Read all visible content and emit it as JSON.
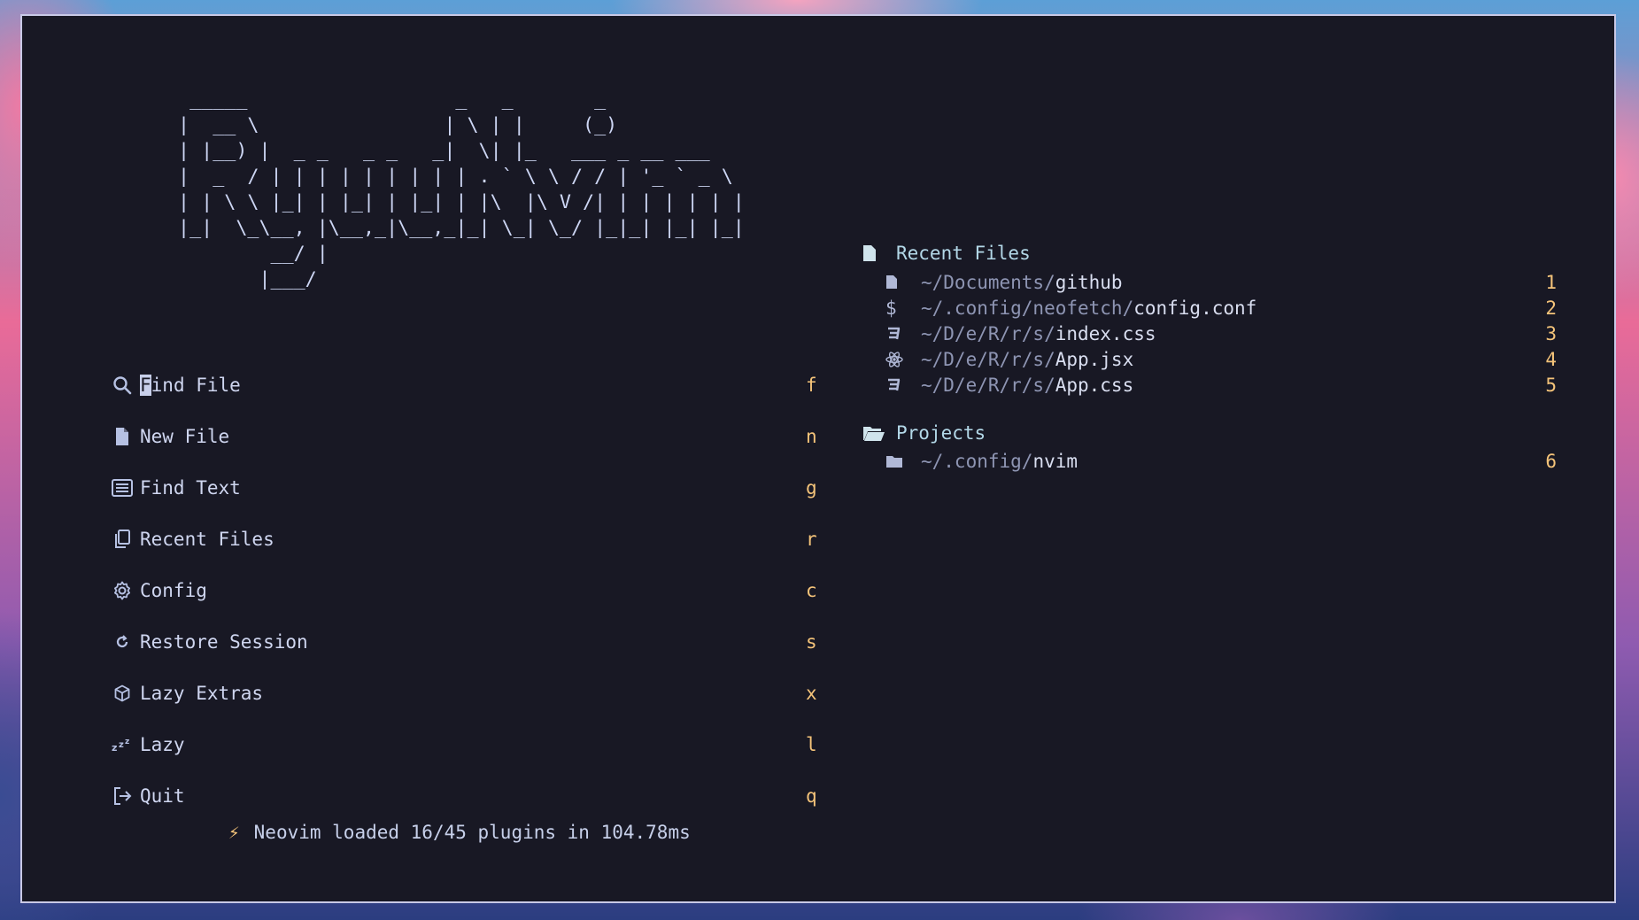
{
  "header_ascii": "  _____                  _   _       _\n |  __ \\                | \\ | |     (_)\n | |__) |  _ _   _ _   _|  \\| |_   ___ _ __ ___\n |  _  / | | | | | | | | | . ` \\ \\ / / | '_ ` _ \\\n | | \\ \\ |_| | |_| | |_| | |\\  |\\ V /| | | | | | |\n |_|  \\_\\__, |\\__,_|\\__,_|_| \\_| \\_/ |_|_| |_| |_|\n         __/ |\n        |___/",
  "menu": [
    {
      "icon": "search-icon",
      "label": "Find File",
      "key": "f"
    },
    {
      "icon": "file-icon",
      "label": "New File",
      "key": "n"
    },
    {
      "icon": "text-search-icon",
      "label": "Find Text",
      "key": "g"
    },
    {
      "icon": "copy-files-icon",
      "label": "Recent Files",
      "key": "r"
    },
    {
      "icon": "gear-icon",
      "label": "Config",
      "key": "c"
    },
    {
      "icon": "restore-icon",
      "label": "Restore Session",
      "key": "s"
    },
    {
      "icon": "cube-icon",
      "label": "Lazy Extras",
      "key": "x"
    },
    {
      "icon": "sleep-icon",
      "label": "Lazy",
      "key": "l"
    },
    {
      "icon": "exit-icon",
      "label": "Quit",
      "key": "q"
    }
  ],
  "recent_files": {
    "title": "Recent Files",
    "items": [
      {
        "icon": "file-icon",
        "dir": "~/Documents/",
        "name": "github",
        "key": "1"
      },
      {
        "icon": "dollar-icon",
        "dir": "~/.config/neofetch/",
        "name": "config.conf",
        "key": "2"
      },
      {
        "icon": "css-icon",
        "dir": "~/D/e/R/r/s/",
        "name": "index.css",
        "key": "3"
      },
      {
        "icon": "react-icon",
        "dir": "~/D/e/R/r/s/",
        "name": "App.jsx",
        "key": "4"
      },
      {
        "icon": "css-icon",
        "dir": "~/D/e/R/r/s/",
        "name": "App.css",
        "key": "5"
      }
    ]
  },
  "projects": {
    "title": "Projects",
    "items": [
      {
        "icon": "folder-icon",
        "dir": "~/.config/",
        "name": "nvim",
        "key": "6"
      }
    ]
  },
  "footer": {
    "text": "Neovim loaded 16/45 plugins in 104.78ms"
  },
  "colors": {
    "background": "#181824",
    "key": "#f5c47a",
    "section_title": "#b3d8e8",
    "dir": "#8e95b3"
  }
}
